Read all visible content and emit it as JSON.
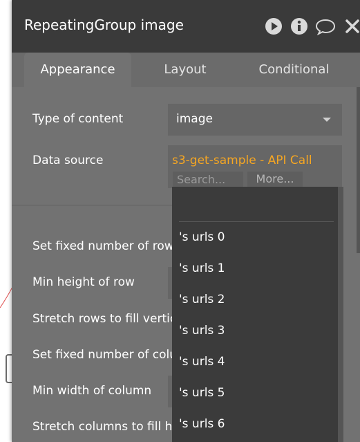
{
  "window": {
    "title": "RepeatingGroup image"
  },
  "tabs": [
    {
      "label": "Appearance",
      "active": true
    },
    {
      "label": "Layout",
      "active": false
    },
    {
      "label": "Conditional",
      "active": false
    }
  ],
  "fields": {
    "type_of_content": {
      "label": "Type of content",
      "value": "image"
    },
    "data_source": {
      "label": "Data source",
      "value": "s3-get-sample - API Call",
      "search_placeholder": "Search...",
      "more_label": "More..."
    },
    "other_labels": [
      "Set fixed number of row",
      "Min height of row",
      "Stretch rows to fill vertic",
      "Set fixed number of colu",
      "Min width of column",
      "Stretch columns to fill ho"
    ]
  },
  "dropdown": {
    "items": [
      "'s urls 0",
      "'s urls 1",
      "'s urls 2",
      "'s urls 3",
      "'s urls 4",
      "'s urls 5",
      "'s urls 6"
    ]
  },
  "colors": {
    "titlebar": "#3a3a3a",
    "panel": "#727272",
    "accent": "#f5a623",
    "dropdown": "#3b3b3b"
  },
  "icons": [
    "play-icon",
    "info-icon",
    "comment-icon",
    "close-icon",
    "dropdown-arrow-icon"
  ]
}
